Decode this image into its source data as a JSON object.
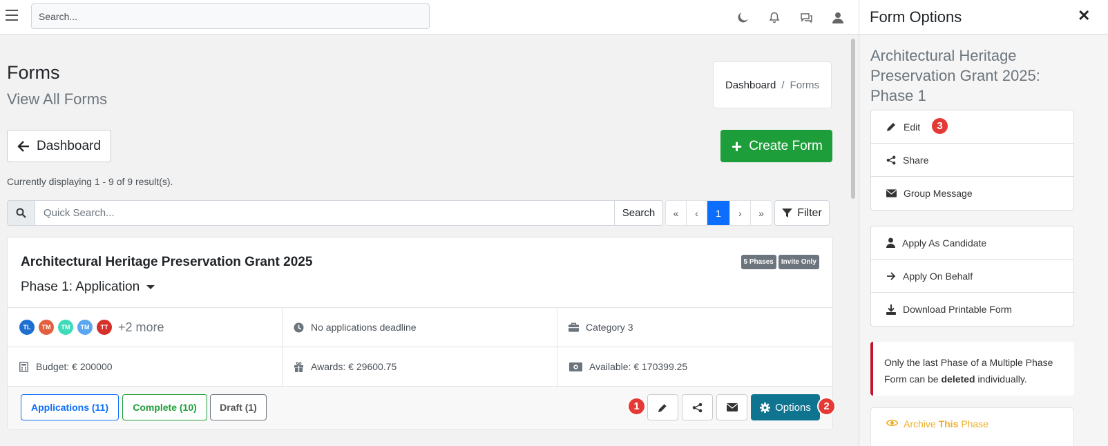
{
  "topbar": {
    "search_placeholder": "Search...",
    "icons": [
      "menu-icon",
      "moon-icon",
      "bell-icon",
      "chat-icon",
      "user-icon"
    ]
  },
  "header": {
    "title": "Forms",
    "subtitle": "View All Forms",
    "breadcrumb": {
      "home": "Dashboard",
      "separator": "/",
      "current": "Forms"
    }
  },
  "toolbar": {
    "back_label": "Dashboard",
    "create_label": "Create Form",
    "result_text": "Currently displaying 1 - 9 of 9 result(s).",
    "quick_search_placeholder": "Quick Search...",
    "search_label": "Search",
    "pager": {
      "first": "«",
      "prev": "‹",
      "current": "1",
      "next": "›",
      "last": "»"
    },
    "filter_label": "Filter"
  },
  "form_card": {
    "title": "Architectural Heritage Preservation Grant 2025",
    "badges": [
      "5 Phases",
      "Invite Only"
    ],
    "phase": "Phase 1: Application",
    "avatars": [
      {
        "initials": "TL",
        "color": "#1f6fd1"
      },
      {
        "initials": "TM",
        "color": "#e2603f"
      },
      {
        "initials": "TM",
        "color": "#3ddbb8"
      },
      {
        "initials": "TM",
        "color": "#5aa6f0"
      },
      {
        "initials": "TT",
        "color": "#d6302b"
      }
    ],
    "more": "+2 more",
    "deadline": "No applications deadline",
    "category": "Category 3",
    "budget": "Budget: € 200000",
    "awards": "Awards: € 29600.75",
    "available": "Available: € 170399.25",
    "applications_label": "Applications (11)",
    "complete_label": "Complete (10)",
    "draft_label": "Draft (1)",
    "options_label": "Options"
  },
  "markers": [
    "1",
    "2",
    "3"
  ],
  "side_panel": {
    "title": "Form Options",
    "close": "✕",
    "form_title": "Architectural Heritage Preservation Grant 2025: Phase 1",
    "group1": [
      "Edit",
      "Share",
      "Group Message"
    ],
    "group2": [
      "Apply As Candidate",
      "Apply On Behalf",
      "Download Printable Form"
    ],
    "alert": {
      "before": "Only the last Phase of a Multiple Phase Form can be ",
      "bold": "deleted",
      "after": " individually."
    },
    "archive": {
      "before": "Archive ",
      "bold": "This",
      "after": " Phase"
    }
  },
  "colors": {
    "primary": "#0d6efd",
    "success": "#1e9e3a",
    "teal": "#0e7490",
    "danger": "#c0172c",
    "warning": "#f0ad24"
  }
}
